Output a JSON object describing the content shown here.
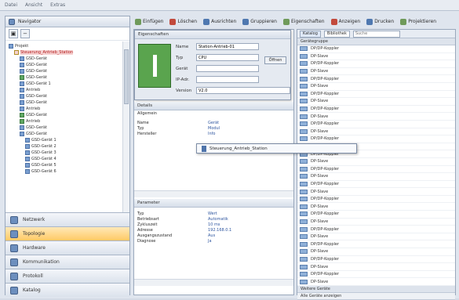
{
  "menu": [
    "Datei",
    "Ansicht",
    "Extras"
  ],
  "navigator": {
    "title": "Navigator",
    "tree": [
      {
        "label": "Projekt",
        "indent": 0,
        "icon": "b"
      },
      {
        "label": "Steuerung_Antrieb_Station",
        "indent": 1,
        "icon": "y",
        "selected": true
      },
      {
        "label": "GSD-Gerät",
        "indent": 2,
        "icon": "b"
      },
      {
        "label": "GSD-Gerät",
        "indent": 2,
        "icon": "b"
      },
      {
        "label": "GSD-Gerät",
        "indent": 2,
        "icon": "b"
      },
      {
        "label": "GSD-Gerät",
        "indent": 2,
        "icon": "g"
      },
      {
        "label": "GSD-Gerät 1",
        "indent": 2,
        "icon": "b"
      },
      {
        "label": "Antrieb",
        "indent": 2,
        "icon": "b"
      },
      {
        "label": "GSD-Gerät",
        "indent": 2,
        "icon": "b"
      },
      {
        "label": "GSD-Gerät",
        "indent": 2,
        "icon": "b"
      },
      {
        "label": "Antrieb",
        "indent": 2,
        "icon": "b"
      },
      {
        "label": "GSD-Gerät",
        "indent": 2,
        "icon": "g"
      },
      {
        "label": "Antrieb",
        "indent": 2,
        "icon": "g"
      },
      {
        "label": "GSD-Gerät",
        "indent": 2,
        "icon": "b"
      },
      {
        "label": "GSD-Gerät",
        "indent": 2,
        "icon": "b"
      },
      {
        "label": "GSD-Gerät 1",
        "indent": 3,
        "icon": "b"
      },
      {
        "label": "GSD-Gerät 2",
        "indent": 3,
        "icon": "b"
      },
      {
        "label": "GSD-Gerät 3",
        "indent": 3,
        "icon": "b"
      },
      {
        "label": "GSD-Gerät 4",
        "indent": 3,
        "icon": "b"
      },
      {
        "label": "GSD-Gerät 5",
        "indent": 3,
        "icon": "b"
      },
      {
        "label": "GSD-Gerät 6",
        "indent": 3,
        "icon": "b"
      }
    ],
    "buttons": [
      {
        "label": "Netzwerk",
        "active": false
      },
      {
        "label": "Topologie",
        "active": true
      },
      {
        "label": "Hardware",
        "active": false
      },
      {
        "label": "Kommunikation",
        "active": false
      },
      {
        "label": "Protokoll",
        "active": false
      },
      {
        "label": "Katalog",
        "active": false
      }
    ]
  },
  "toolbar": {
    "items": [
      "Einfügen",
      "Löschen",
      "Ausrichten",
      "Gruppieren",
      "Eigenschaften",
      "Anzeigen",
      "Drucken",
      "Projektieren"
    ]
  },
  "properties": {
    "title": "Eigenschaften",
    "rows": [
      {
        "label": "Name",
        "value": "Station-Antrieb-01"
      },
      {
        "label": "Typ",
        "value": "CPU"
      },
      {
        "label": "Gerät",
        "value": ""
      },
      {
        "label": "IP-Adr.",
        "value": ""
      },
      {
        "label": "Version",
        "value": "V2.0"
      }
    ],
    "open_button": "Öffnen",
    "section1_title": "Details",
    "section1_sub": "Allgemein",
    "section1_items": [
      {
        "k": "Name",
        "v": "Gerät"
      },
      {
        "k": "Typ",
        "v": "Modul"
      },
      {
        "k": "Hersteller",
        "v": "Info"
      }
    ],
    "section2_title": "Parameter",
    "section2_items": [
      {
        "k": "Typ",
        "v": "Wert"
      },
      {
        "k": "Betriebsart",
        "v": "Automatik"
      },
      {
        "k": "Zykluszeit",
        "v": "10 ms"
      },
      {
        "k": "Adresse",
        "v": "192.168.0.1"
      },
      {
        "k": "Ausgangszustand",
        "v": "Aus"
      },
      {
        "k": "Diagnose",
        "v": "Ja"
      }
    ]
  },
  "tooltip": {
    "text": "Steuerung_Antrieb_Station"
  },
  "catalog": {
    "tab1": "Katalog",
    "tab2": "Bibliothek",
    "search_placeholder": "Suche",
    "group1": "Gerätegruppe",
    "group2": "Weitere Geräte",
    "group3": "Alle Geräte anzeigen",
    "rows": [
      "DP/DP-Koppler",
      "DP-Slave",
      "DP/DP-Koppler",
      "DP-Slave",
      "DP/DP-Koppler",
      "DP-Slave",
      "DP/DP-Koppler",
      "DP-Slave",
      "DP/DP-Koppler",
      "DP-Slave",
      "DP/DP-Koppler",
      "DP-Slave",
      "DP/DP-Koppler",
      "DP-Slave",
      "DP/DP-Koppler",
      "DP-Slave",
      "DP/DP-Koppler",
      "DP-Slave",
      "DP/DP-Koppler",
      "DP-Slave",
      "DP/DP-Koppler",
      "DP-Slave",
      "DP/DP-Koppler",
      "DP-Slave",
      "DP/DP-Koppler",
      "DP-Slave",
      "DP/DP-Koppler",
      "DP-Slave",
      "DP/DP-Koppler",
      "DP-Slave",
      "DP/DP-Koppler",
      "DP-Slave"
    ]
  }
}
